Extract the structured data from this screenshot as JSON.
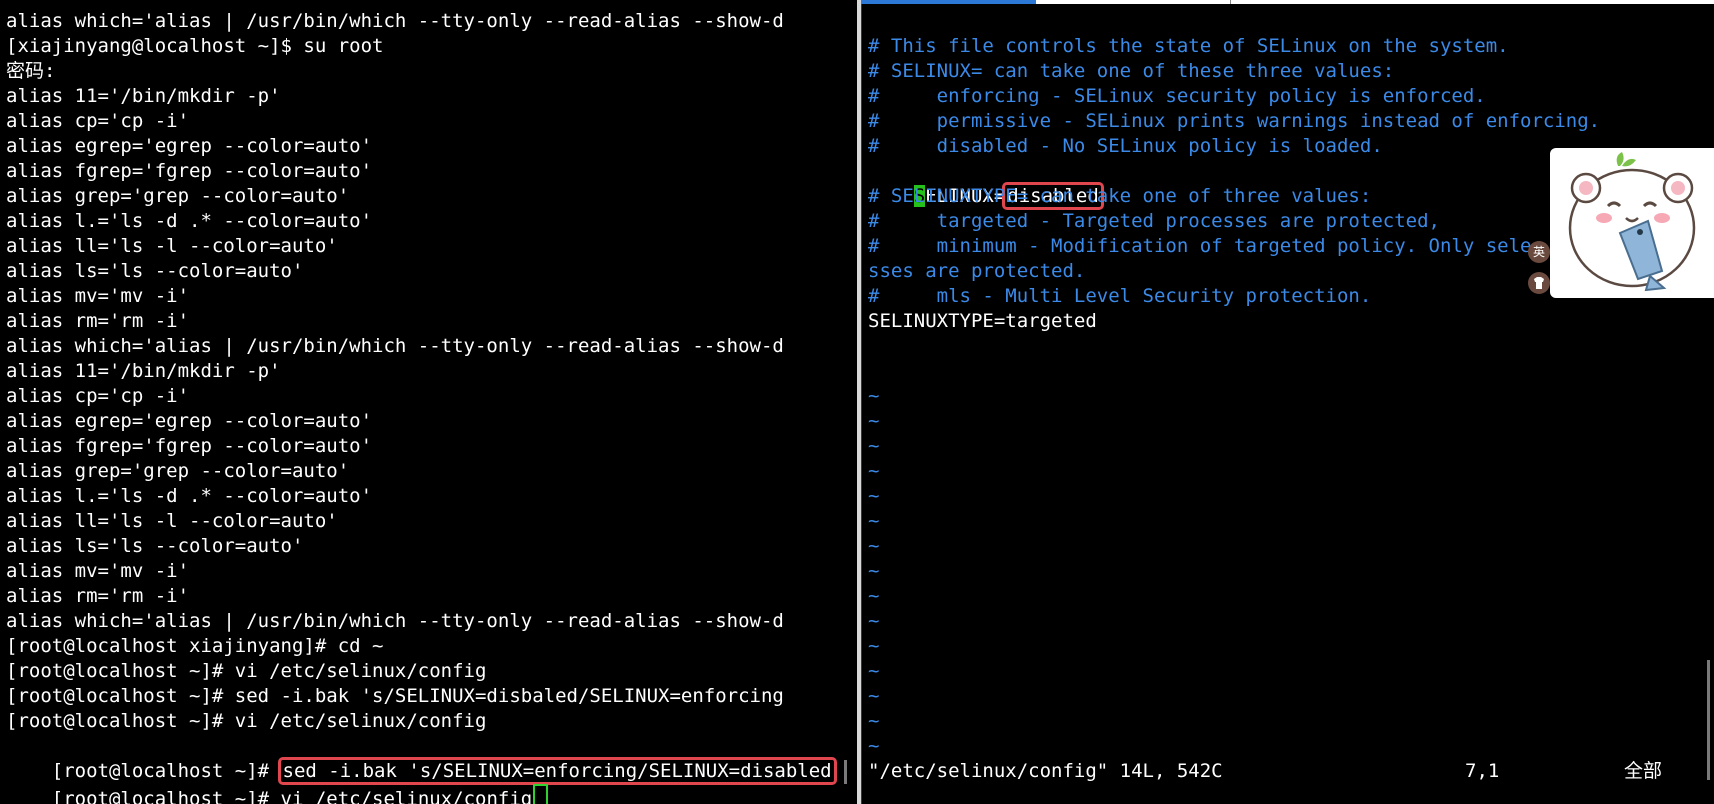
{
  "left_terminal": {
    "lines": [
      "alias which='alias | /usr/bin/which --tty-only --read-alias --show-d",
      "[xiajinyang@localhost ~]$ su root",
      "密码:",
      "alias 11='/bin/mkdir -p'",
      "alias cp='cp -i'",
      "alias egrep='egrep --color=auto'",
      "alias fgrep='fgrep --color=auto'",
      "alias grep='grep --color=auto'",
      "alias l.='ls -d .* --color=auto'",
      "alias ll='ls -l --color=auto'",
      "alias ls='ls --color=auto'",
      "alias mv='mv -i'",
      "alias rm='rm -i'",
      "alias which='alias | /usr/bin/which --tty-only --read-alias --show-d",
      "alias 11='/bin/mkdir -p'",
      "alias cp='cp -i'",
      "alias egrep='egrep --color=auto'",
      "alias fgrep='fgrep --color=auto'",
      "alias grep='grep --color=auto'",
      "alias l.='ls -d .* --color=auto'",
      "alias ll='ls -l --color=auto'",
      "alias ls='ls --color=auto'",
      "alias mv='mv -i'",
      "alias rm='rm -i'",
      "alias which='alias | /usr/bin/which --tty-only --read-alias --show-d",
      "[root@localhost xiajinyang]# cd ~",
      "[root@localhost ~]# vi /etc/selinux/config",
      "[root@localhost ~]# sed -i.bak 's/SELINUX=disbaled/SELINUX=enforcing",
      "[root@localhost ~]# vi /etc/selinux/config"
    ],
    "highlight_prompt": "[root@localhost ~]# ",
    "highlight_command": "sed -i.bak 's/SELINUX=enforcing/SELINUX=disabled",
    "last_prompt": "[root@localhost ~]# ",
    "last_command": "vi /etc/selinux/config"
  },
  "right_editor": {
    "comments_top": [
      "# This file controls the state of SELinux on the system.",
      "# SELINUX= can take one of these three values:",
      "#     enforcing - SELinux security policy is enforced.",
      "#     permissive - SELinux prints warnings instead of enforcing.",
      "#     disabled - No SELinux policy is loaded."
    ],
    "selinux_cursor_char": "S",
    "selinux_key_rest": "ELINUX=",
    "selinux_value": "disabled",
    "comments_type": [
      "# SELINUXTYPE= can take one of three values:",
      "#     targeted - Targeted processes are protected,",
      "#     minimum - Modification of targeted policy. Only selec",
      "sses are protected.",
      "#     mls - Multi Level Security protection."
    ],
    "selinuxtype_line": "SELINUXTYPE=targeted",
    "tilde": "~",
    "status_file": "\"/etc/selinux/config\" 14L, 542C",
    "status_pos": "7,1",
    "status_mode": "全部"
  },
  "ime": {
    "lang_label": "英",
    "icon": "shirt-icon"
  },
  "colors": {
    "comment": "#3b8ae8",
    "highlight": "#e0464e",
    "cursor": "#26c21c"
  }
}
